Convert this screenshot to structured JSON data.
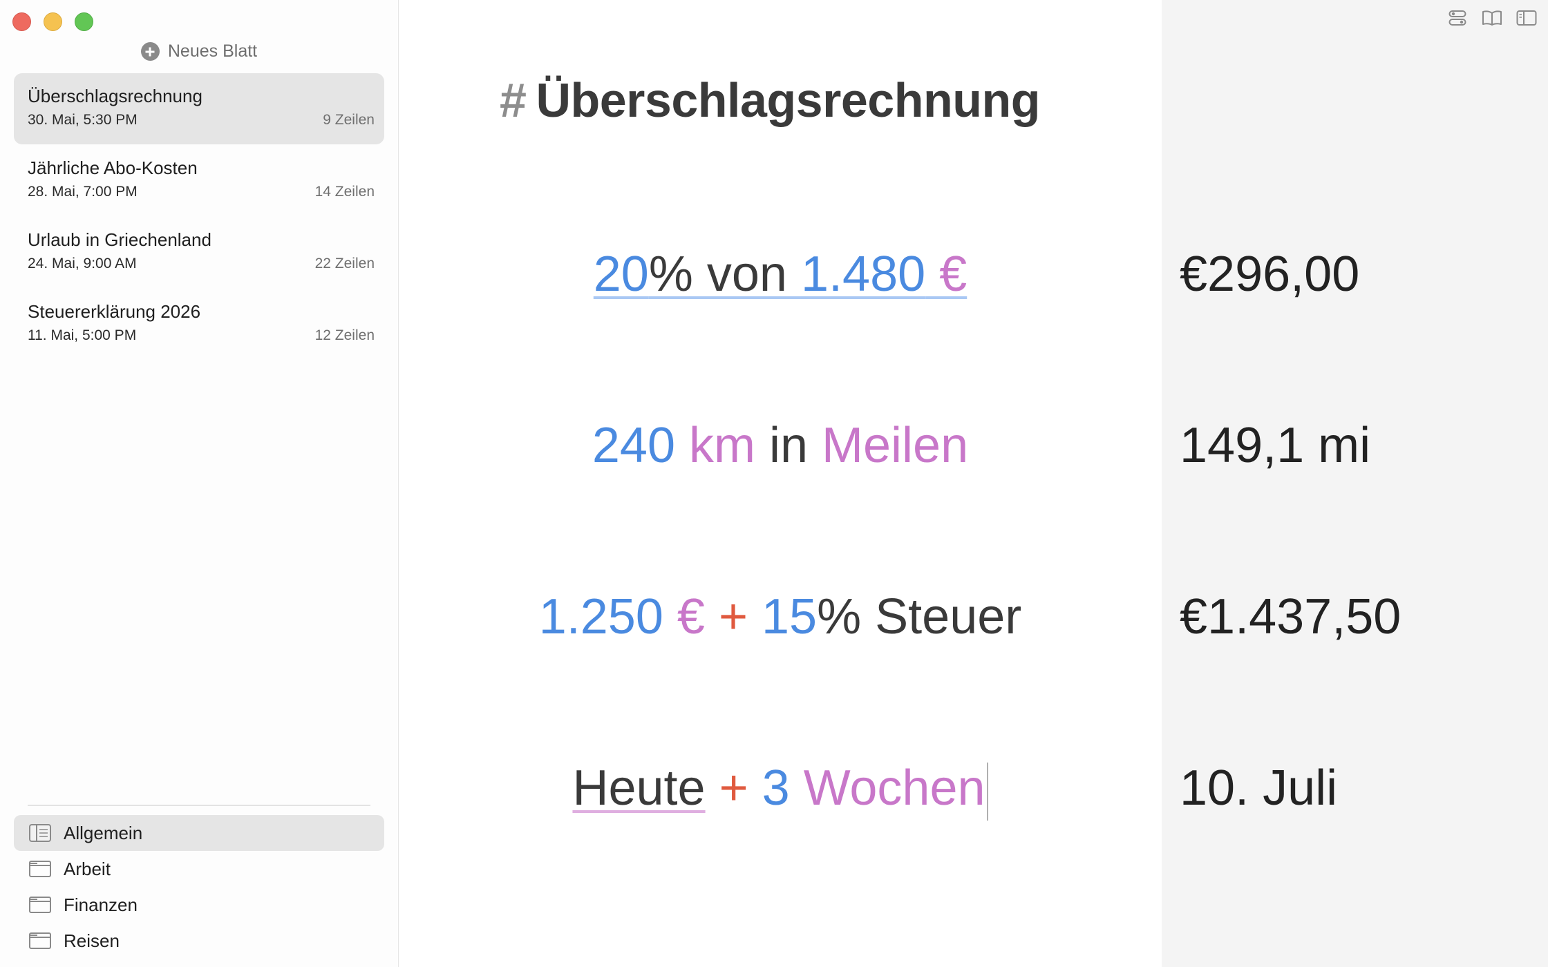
{
  "sidebar": {
    "new_sheet_label": "Neues Blatt",
    "sheets": [
      {
        "title": "Überschlagsrechnung",
        "date": "30. Mai, 5:30 PM",
        "lines": "9 Zeilen",
        "active": true
      },
      {
        "title": "Jährliche Abo-Kosten",
        "date": "28. Mai, 7:00 PM",
        "lines": "14 Zeilen"
      },
      {
        "title": "Urlaub in Griechenland",
        "date": "24. Mai, 9:00 AM",
        "lines": "22 Zeilen"
      },
      {
        "title": "Steuererklärung 2026",
        "date": "11. Mai, 5:00 PM",
        "lines": "12 Zeilen"
      }
    ],
    "folders": [
      {
        "label": "Allgemein",
        "active": true
      },
      {
        "label": "Arbeit"
      },
      {
        "label": "Finanzen"
      },
      {
        "label": "Reisen"
      }
    ]
  },
  "editor": {
    "heading_hash": "#",
    "heading_text": "Überschlagsrechnung",
    "lines": [
      {
        "tokens": [
          "20",
          "% von ",
          "1.480",
          " €"
        ]
      },
      {
        "tokens": [
          "240",
          " km",
          " in ",
          "Meilen"
        ]
      },
      {
        "tokens": [
          "1.250",
          " €",
          " + ",
          "15",
          "% Steuer"
        ]
      },
      {
        "tokens": [
          "Heute",
          " + ",
          "3",
          " Wochen"
        ]
      }
    ]
  },
  "results": [
    "€296,00",
    "149,1 mi",
    "€1.437,50",
    "10. Juli"
  ],
  "colors": {
    "number": "#4a8ae0",
    "unit": "#c877c9",
    "operator": "#e05a3f",
    "text": "#3a3a3a",
    "selection": "#e5e5e5",
    "results_panel": "#f4f4f4"
  },
  "icons": {
    "toolbar": [
      "toggle-settings-icon",
      "book-icon",
      "sidebar-icon"
    ],
    "folders": [
      "notebook-icon",
      "folder-icon",
      "folder-icon",
      "folder-icon"
    ]
  }
}
